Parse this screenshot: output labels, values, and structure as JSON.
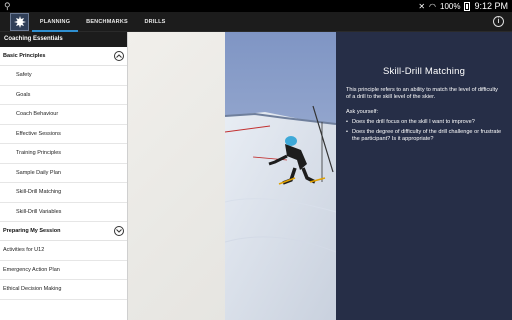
{
  "status_bar": {
    "usb_icon": "usb-icon",
    "battery_percent": "100%",
    "time": "9:12 PM"
  },
  "app_bar": {
    "tabs": [
      {
        "label": "PLANNING",
        "active": true
      },
      {
        "label": "BENCHMARKS",
        "active": false
      },
      {
        "label": "DRILLS",
        "active": false
      }
    ],
    "info_icon": "info-icon",
    "accent": "#2f8fd0"
  },
  "sidebar": {
    "header": "Coaching Essentials",
    "sections": [
      {
        "label": "Basic Principles",
        "expanded": true,
        "items": [
          "Safety",
          "Goals",
          "Coach Behaviour",
          "Effective Sessions",
          "Training Principles",
          "Sample Daily Plan",
          "Skill-Drill Matching",
          "Skill-Drill Variables"
        ]
      },
      {
        "label": "Preparing My Session",
        "expanded": false,
        "items": [
          "Activities for U12",
          "Emergency Action Plan",
          "Ethical Decision Making"
        ]
      }
    ]
  },
  "content": {
    "title": "Skill-Drill Matching",
    "intro": "This principle refers to an ability to match the level of difficulty of a drill to the skill level of the skier.",
    "ask_label": "Ask yourself:",
    "questions": [
      "Does the drill focus on the skill I want to improve?",
      "Does the degree of difficulty of the drill challenge or frustrate the participant? Is it appropriate?"
    ],
    "panel_color": "#262e47"
  }
}
